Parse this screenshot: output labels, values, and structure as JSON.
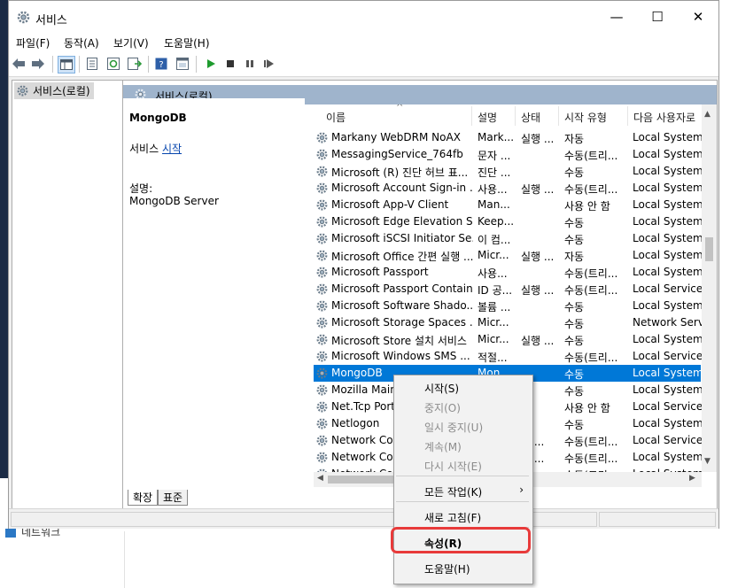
{
  "window": {
    "title": "서비스",
    "controls": {
      "minimize": "—",
      "maximize": "☐",
      "close": "✕"
    }
  },
  "menu": [
    {
      "label": "파일(F)"
    },
    {
      "label": "동작(A)"
    },
    {
      "label": "보기(V)"
    },
    {
      "label": "도움말(H)"
    }
  ],
  "toolbar": {
    "icons": [
      "back-arrow-icon",
      "forward-arrow-icon",
      "show-console-tree-icon",
      "properties-icon",
      "refresh-icon",
      "export-list-icon",
      "help-icon",
      "mmc-view-icon",
      "play-icon",
      "stop-icon",
      "pause-icon",
      "restart-icon"
    ]
  },
  "tree": {
    "root_label": "서비스(로컬)"
  },
  "pane": {
    "header": "서비스(로컬)",
    "selected_service": "MongoDB",
    "start_prefix": "서비스",
    "start_link": "시작",
    "desc_label": "설명:",
    "desc_value": "MongoDB Server"
  },
  "columns": [
    "이름",
    "설명",
    "상태",
    "시작 유형",
    "다음 사용자로"
  ],
  "services": [
    {
      "name": "Markany WebDRM NoAX",
      "desc": "Mark...",
      "status": "실행 ...",
      "start": "자동",
      "logon": "Local System"
    },
    {
      "name": "MessagingService_764fb",
      "desc": "문자 ...",
      "status": "",
      "start": "수동(트리...",
      "logon": "Local System"
    },
    {
      "name": "Microsoft (R) 진단 허브 표...",
      "desc": "진단 ...",
      "status": "",
      "start": "수동",
      "logon": "Local System"
    },
    {
      "name": "Microsoft Account Sign-in ...",
      "desc": "사용...",
      "status": "실행 ...",
      "start": "수동(트리...",
      "logon": "Local System"
    },
    {
      "name": "Microsoft App-V Client",
      "desc": "Man...",
      "status": "",
      "start": "사용 안 함",
      "logon": "Local System"
    },
    {
      "name": "Microsoft Edge Elevation S...",
      "desc": "Keep...",
      "status": "",
      "start": "수동",
      "logon": "Local System"
    },
    {
      "name": "Microsoft iSCSI Initiator Se...",
      "desc": "이 컴...",
      "status": "",
      "start": "수동",
      "logon": "Local System"
    },
    {
      "name": "Microsoft Office 간편 실행 ...",
      "desc": "Micr...",
      "status": "실행 ...",
      "start": "자동",
      "logon": "Local System"
    },
    {
      "name": "Microsoft Passport",
      "desc": "사용...",
      "status": "",
      "start": "수동(트리...",
      "logon": "Local System"
    },
    {
      "name": "Microsoft Passport Container",
      "desc": "ID 공...",
      "status": "실행 ...",
      "start": "수동(트리...",
      "logon": "Local Service"
    },
    {
      "name": "Microsoft Software Shado...",
      "desc": "볼륨 ...",
      "status": "",
      "start": "수동",
      "logon": "Local System"
    },
    {
      "name": "Microsoft Storage Spaces ...",
      "desc": "Micr...",
      "status": "",
      "start": "수동",
      "logon": "Network Servi"
    },
    {
      "name": "Microsoft Store 설치 서비스",
      "desc": "Micr...",
      "status": "실행 ...",
      "start": "수동",
      "logon": "Local System"
    },
    {
      "name": "Microsoft Windows SMS ...",
      "desc": "적절...",
      "status": "",
      "start": "수동(트리...",
      "logon": "Local Service"
    },
    {
      "name": "MongoDB",
      "desc": "Mon...",
      "status": "",
      "start": "수동",
      "logon": "Local System"
    },
    {
      "name": "Mozilla Main",
      "desc": "",
      "status": "",
      "start": "수동",
      "logon": "Local System"
    },
    {
      "name": "Net.Tcp Port",
      "desc": "",
      "status": "",
      "start": "사용 안 함",
      "logon": "Local Service"
    },
    {
      "name": "Netlogon",
      "desc": "",
      "status": "",
      "start": "수동",
      "logon": "Local System"
    },
    {
      "name": "Network Con",
      "desc": "",
      "status": "행 ...",
      "start": "수동(트리...",
      "logon": "Local Service"
    },
    {
      "name": "Network Con",
      "desc": "",
      "status": "행 ...",
      "start": "수동(트리...",
      "logon": "Local System"
    },
    {
      "name": "Network Con",
      "desc": "",
      "status": "행 ...",
      "start": "수동(트리...",
      "logon": "Local System"
    }
  ],
  "selected_index": 14,
  "tabs": [
    {
      "label": "확장"
    },
    {
      "label": "표준"
    }
  ],
  "context_menu": [
    {
      "label": "시작(S)",
      "enabled": true
    },
    {
      "label": "중지(O)",
      "enabled": false
    },
    {
      "label": "일시 중지(U)",
      "enabled": false
    },
    {
      "label": "계속(M)",
      "enabled": false
    },
    {
      "label": "다시 시작(E)",
      "enabled": false
    },
    {
      "label": "모든 작업(K)",
      "enabled": true,
      "submenu": "›"
    },
    {
      "label": "새로 고침(F)",
      "enabled": true
    },
    {
      "label": "속성(R)",
      "enabled": true,
      "highlighted": true
    },
    {
      "label": "도움말(H)",
      "enabled": true
    }
  ],
  "background": {
    "network_label": "네트워크"
  },
  "colors": {
    "selection": "#0078d7",
    "pane_header": "#9fb4cc",
    "highlight_ring": "#e83a3a",
    "link": "#0645ad"
  }
}
